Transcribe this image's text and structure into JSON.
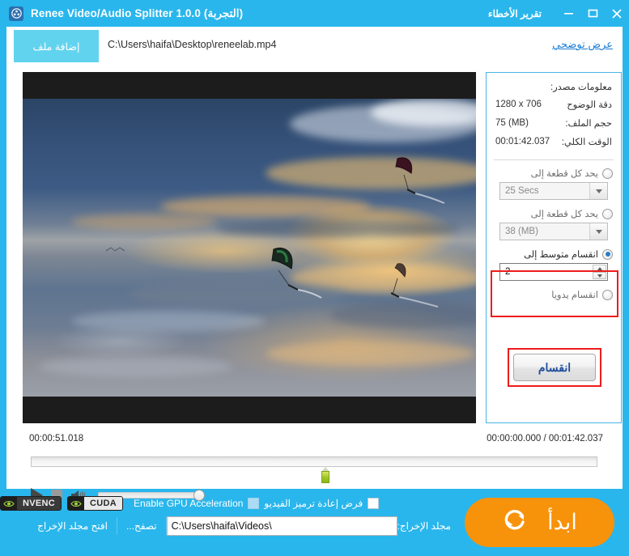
{
  "window": {
    "title": "Renee Video/Audio Splitter 1.0.0 (التجربة)",
    "app_icon": "film-reel-icon",
    "error_report": "تقرير الأخطاء",
    "minimize": "−",
    "maximize": "□",
    "close": "✕",
    "titlebar_color": "#29b6ec"
  },
  "toolbar": {
    "add_file_label": "إضافة ملف",
    "file_path": "C:\\Users\\haifa\\Desktop\\reneelab.mp4",
    "demo_link": "عرض توضحي"
  },
  "options": {
    "info_title": "معلومات مصدر:",
    "info_rows": [
      {
        "label": "دقة الوضوح",
        "value": "1280 x 706"
      },
      {
        "label": "حجم الملف:",
        "value": "75 (MB)"
      },
      {
        "label": "الوقت الكلي:",
        "value": "00:01:42.037"
      }
    ],
    "split_modes": [
      {
        "label": "يحد كل قطعة إلى",
        "selected": false,
        "field_value": "25 Secs",
        "field_type": "combo"
      },
      {
        "label": "يحد كل قطعة إلى",
        "selected": false,
        "field_value": "38 (MB)",
        "field_type": "combo"
      },
      {
        "label": "انقسام متوسط إلى",
        "selected": true,
        "field_value": "2",
        "field_type": "spinner"
      },
      {
        "label": "انقسام يدويا",
        "selected": false,
        "field_value": "",
        "field_type": "none"
      }
    ],
    "split_button": "انقسام",
    "highlight_color": "#ee1c1c"
  },
  "player": {
    "current_time": "00:00:51.018",
    "range_time": "00:00:00.000 / 00:01:42.037",
    "play_icon": "play-icon",
    "stop_icon": "stop-icon",
    "volume_icon": "volume-icon",
    "marker_position_percent": 51,
    "volume_percent": 100
  },
  "bottom": {
    "force_recode_label": "فرض إعادة ترميز الفيديو",
    "force_recode_checked": false,
    "gpu_accel_label": "Enable GPU Acceleration",
    "gpu_accel_checked": false,
    "badges": [
      {
        "name": "CUDA",
        "state": "light"
      },
      {
        "name": "NVENC",
        "state": "dark"
      }
    ],
    "output_label": "مجلد الإخراج:",
    "output_path": "C:\\Users\\haifa\\Videos\\",
    "browse_label": "تصفح...",
    "open_folder_label": "افتح مجلد الإخراج",
    "start_label": "ابدأ",
    "start_icon": "refresh-loop-icon",
    "start_color": "#f7920b"
  }
}
